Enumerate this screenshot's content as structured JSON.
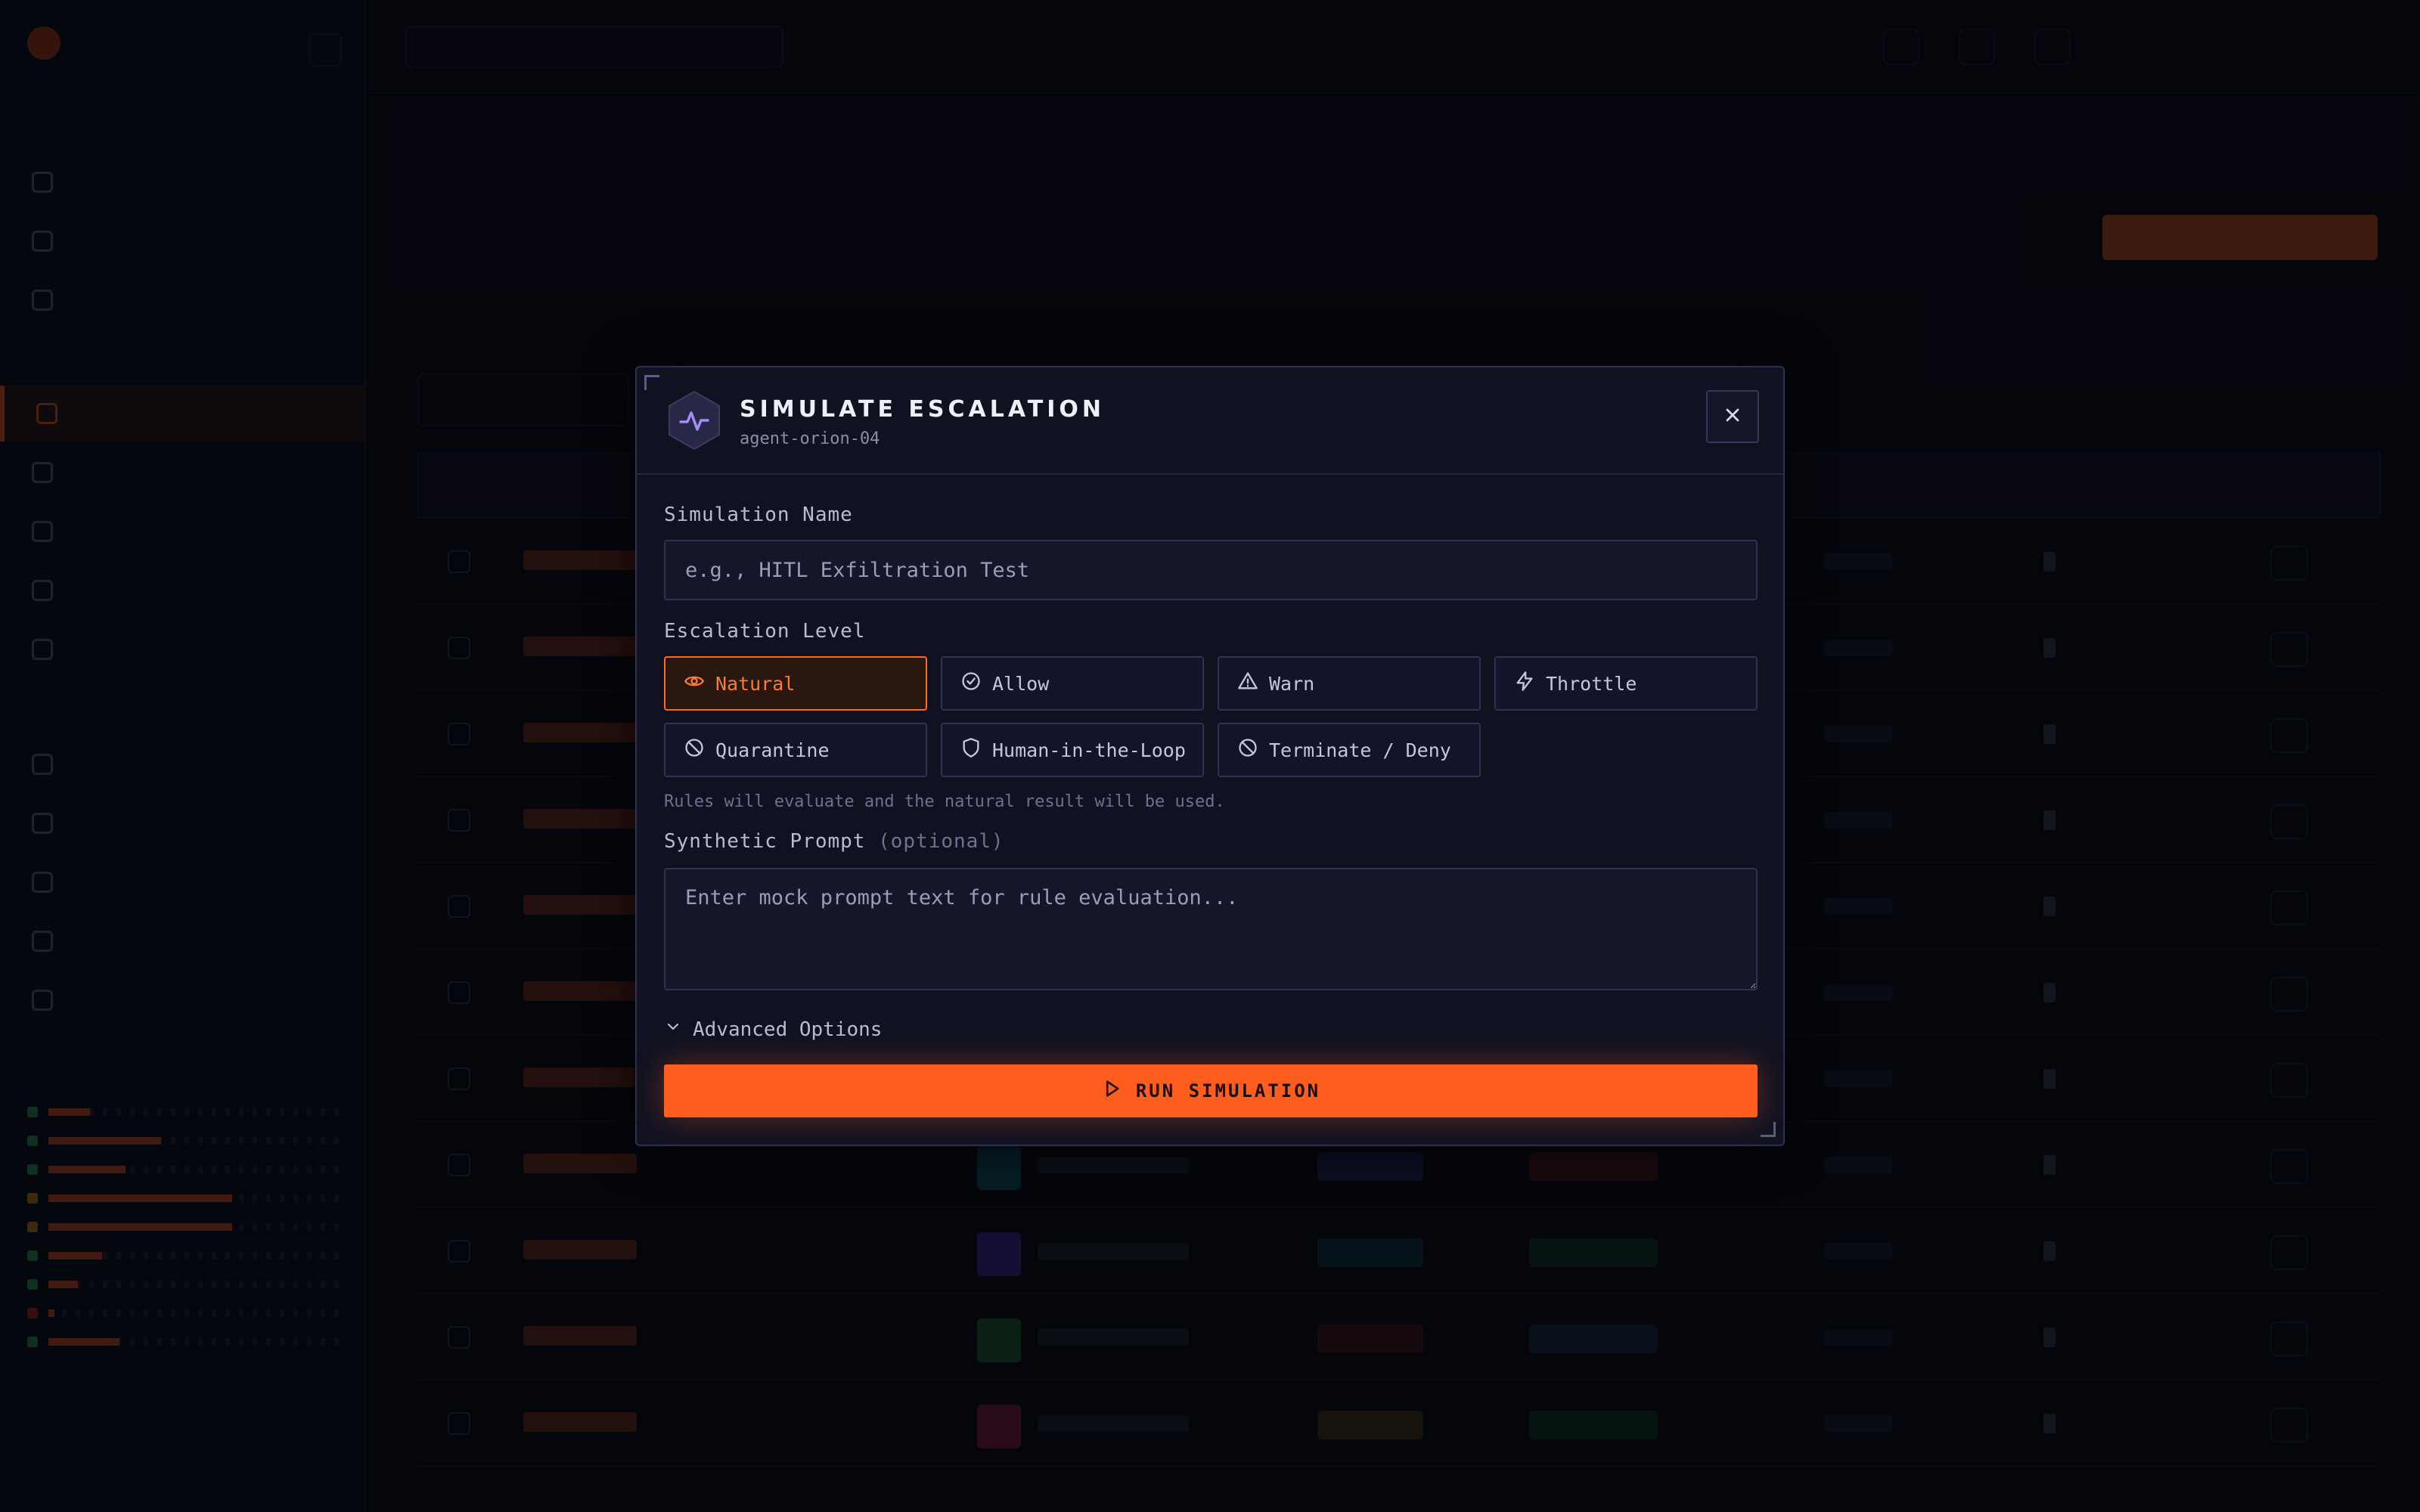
{
  "colors": {
    "accent": "#ff5e1f",
    "modal_bg": "#111221",
    "border": "#2f3250",
    "backdrop": "#0b0c14"
  },
  "modal": {
    "title": "SIMULATE ESCALATION",
    "subtitle": "agent-orion-04",
    "header_icon": "activity-pulse-icon",
    "close_icon": "close-icon",
    "simulation_name": {
      "label": "Simulation Name",
      "value": "",
      "placeholder": "e.g., HITL Exfiltration Test"
    },
    "escalation_level": {
      "label": "Escalation Level",
      "selected": "Natural",
      "options": [
        {
          "label": "Natural",
          "icon": "eye-icon"
        },
        {
          "label": "Allow",
          "icon": "check-circle-icon"
        },
        {
          "label": "Warn",
          "icon": "warning-triangle-icon"
        },
        {
          "label": "Throttle",
          "icon": "lightning-icon"
        },
        {
          "label": "Quarantine",
          "icon": "ban-icon"
        },
        {
          "label": "Human-in-the-Loop",
          "icon": "shield-icon"
        },
        {
          "label": "Terminate / Deny",
          "icon": "ban-icon"
        }
      ],
      "hint": "Rules will evaluate and the natural result will be used."
    },
    "synthetic_prompt": {
      "label": "Synthetic Prompt",
      "optional_label": "(optional)",
      "value": "",
      "placeholder": "Enter mock prompt text for rule evaluation..."
    },
    "advanced_options_label": "Advanced Options",
    "run_button_label": "RUN SIMULATION"
  }
}
